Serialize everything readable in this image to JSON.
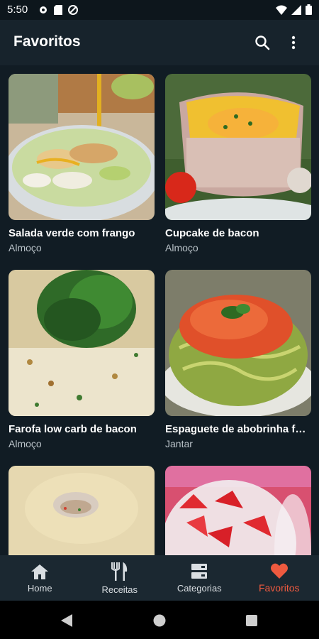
{
  "status_bar": {
    "time": "5:50"
  },
  "app_bar": {
    "title": "Favoritos",
    "icons": [
      "search-icon",
      "more-vert-icon"
    ]
  },
  "recipes": [
    {
      "name": "Salada verde com frango",
      "category": "Almoço"
    },
    {
      "name": "Cupcake de bacon",
      "category": "Almoço"
    },
    {
      "name": "Farofa low carb de bacon",
      "category": "Almoço"
    },
    {
      "name": "Espaguete de abobrinha f…",
      "category": "Jantar"
    },
    {
      "name": "",
      "category": ""
    },
    {
      "name": "",
      "category": ""
    }
  ],
  "bottom_nav": [
    {
      "label": "Home",
      "icon": "home-icon"
    },
    {
      "label": "Receitas",
      "icon": "cutlery-icon"
    },
    {
      "label": "Categorias",
      "icon": "categories-icon"
    },
    {
      "label": "Favoritos",
      "icon": "heart-icon",
      "active": true
    }
  ],
  "colors": {
    "accent": "#ef5a3f",
    "background": "#111c24",
    "app_bar": "#17232c",
    "bottom_nav": "#1b2831"
  }
}
